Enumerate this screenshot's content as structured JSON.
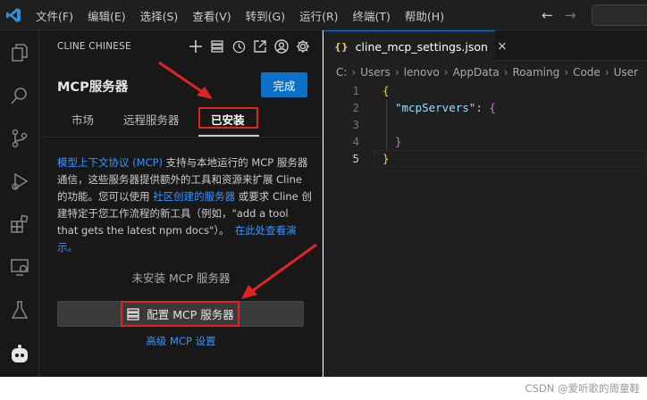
{
  "menu": [
    "文件(F)",
    "编辑(E)",
    "选择(S)",
    "查看(V)",
    "转到(G)",
    "运行(R)",
    "终端(T)",
    "帮助(H)"
  ],
  "nav": {
    "back": "←",
    "forward": "→"
  },
  "sidebar": {
    "header": "CLINE CHINESE",
    "mcp_title": "MCP服务器",
    "done_label": "完成",
    "tabs": [
      "市场",
      "远程服务器",
      "已安装"
    ],
    "desc": {
      "link1": "模型上下文协议 (MCP)",
      "text1": " 支持与本地运行的 MCP 服务器通信，这些服务器提供额外的工具和资源来扩展 Cline 的功能。您可以使用 ",
      "link2": "社区创建的服务器",
      "text2": " 或要求 Cline 创建特定于您工作流程的新工具（例如，\"add a tool that gets the latest npm docs\"）。",
      "link3": "在此处查看演示。"
    },
    "no_mcp": "未安装 MCP 服务器",
    "configure_label": "配置 MCP 服务器",
    "advanced_label": "高级 MCP 设置"
  },
  "editor": {
    "tab_icon": "{}",
    "tab_name": "cline_mcp_settings.json",
    "close": "×",
    "breadcrumb": [
      "C:",
      "Users",
      "lenovo",
      "AppData",
      "Roaming",
      "Code",
      "User"
    ],
    "lines": [
      {
        "n": "1",
        "text": "{"
      },
      {
        "n": "2",
        "key": "\"mcpServers\"",
        "colon": ": ",
        "brace": "{"
      },
      {
        "n": "3",
        "text": ""
      },
      {
        "n": "4",
        "text": "}"
      },
      {
        "n": "5",
        "text": "}"
      }
    ]
  },
  "watermark": "CSDN @爱听歌的周童鞋",
  "colors": {
    "accent": "#0e71c9",
    "highlight_box": "#e02424",
    "link": "#3794ff"
  }
}
